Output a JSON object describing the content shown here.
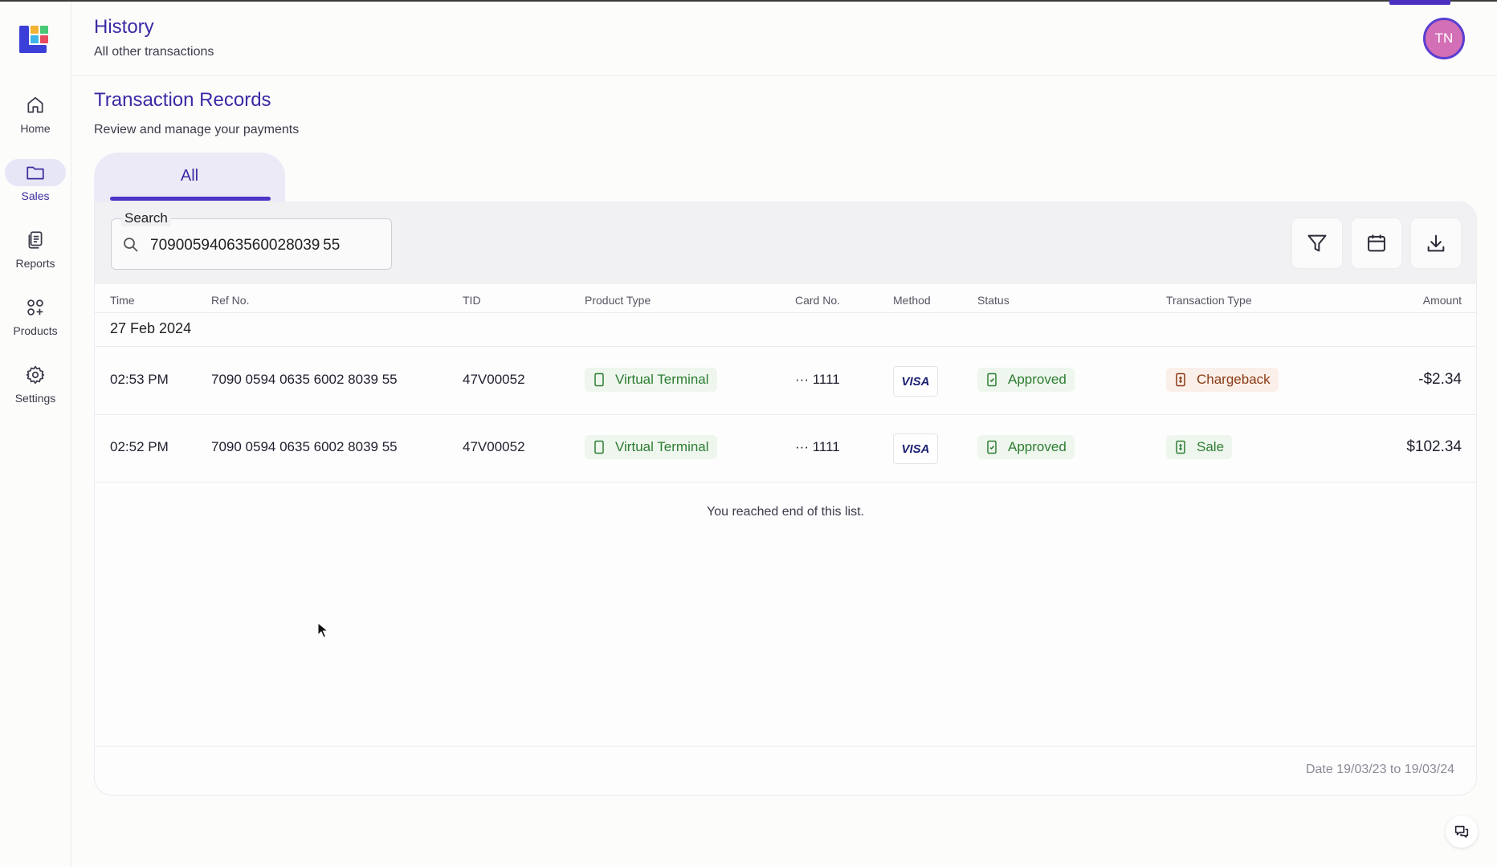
{
  "header": {
    "title": "History",
    "subtitle": "All other transactions",
    "avatar_initials": "TN"
  },
  "sidebar": {
    "items": [
      {
        "label": "Home",
        "icon": "home-icon",
        "active": false
      },
      {
        "label": "Sales",
        "icon": "folder-icon",
        "active": true
      },
      {
        "label": "Reports",
        "icon": "reports-icon",
        "active": false
      },
      {
        "label": "Products",
        "icon": "products-icon",
        "active": false
      },
      {
        "label": "Settings",
        "icon": "gear-icon",
        "active": false
      }
    ]
  },
  "section": {
    "title": "Transaction Records",
    "subtitle": "Review and manage your payments"
  },
  "tabs": [
    {
      "label": "All",
      "active": true
    }
  ],
  "search": {
    "label": "Search",
    "value": "70900594063560028039 55"
  },
  "toolbar": {
    "icons": [
      "filter-icon",
      "calendar-icon",
      "download-icon"
    ]
  },
  "table": {
    "columns": [
      "Time",
      "Ref No.",
      "TID",
      "Product Type",
      "Card No.",
      "Method",
      "Status",
      "Transaction Type",
      "Amount"
    ],
    "date_group": "27 Feb 2024",
    "rows": [
      {
        "time": "02:53 PM",
        "ref_no": "7090 0594 0635 6002 8039 55",
        "tid": "47V00052",
        "product_type": "Virtual Terminal",
        "card_dots": "···",
        "card_last4": "1111",
        "method": "VISA",
        "status": "Approved",
        "transaction_type": "Chargeback",
        "amount": "-$2.34"
      },
      {
        "time": "02:52 PM",
        "ref_no": "7090 0594 0635 6002 8039 55",
        "tid": "47V00052",
        "product_type": "Virtual Terminal",
        "card_dots": "···",
        "card_last4": "1111",
        "method": "VISA",
        "status": "Approved",
        "transaction_type": "Sale",
        "amount": "$102.34"
      }
    ],
    "end_message": "You reached end of this list."
  },
  "footer": {
    "date_range": "Date 19/03/23 to 19/03/24"
  },
  "colors": {
    "accent": "#3a2aa5",
    "tab_underline": "#4b35c6",
    "status_green": "#2e7d32",
    "chargeback_orange": "#8a3a14",
    "avatar_bg": "#d36fb6"
  }
}
